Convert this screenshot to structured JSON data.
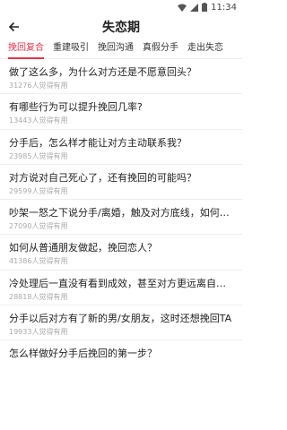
{
  "status_bar": {
    "time": "11:34"
  },
  "app_bar": {
    "back_icon": "arrow-left-icon",
    "title": "失恋期"
  },
  "tabs": [
    {
      "label": "挽回复合",
      "active": true
    },
    {
      "label": "重建吸引",
      "active": false
    },
    {
      "label": "挽回沟通",
      "active": false
    },
    {
      "label": "真假分手",
      "active": false
    },
    {
      "label": "走出失恋",
      "active": false
    }
  ],
  "items": [
    {
      "title": "做了这么多，为什么对方还是不愿意回头？",
      "meta": "31276人觉得有用"
    },
    {
      "title": "有哪些行为可以提升挽回几率?",
      "meta": "13443人觉得有用"
    },
    {
      "title": "分手后，怎么样才能让对方主动联系我？",
      "meta": "23985人觉得有用"
    },
    {
      "title": "对方说对自己死心了，还有挽回的可能吗？",
      "meta": "29599人觉得有用"
    },
    {
      "title": "吵架一怒之下说分手/离婚，触及对方底线，如何挽回",
      "meta": "27090人觉得有用"
    },
    {
      "title": "如何从普通朋友做起，挽回恋人？",
      "meta": "41386人觉得有用"
    },
    {
      "title": "冷处理后一直没有看到成效，甚至对方更远离自己，",
      "meta": "28818人觉得有用"
    },
    {
      "title": "分手以后对方有了新的男/女朋友，这时还想挽回TA",
      "meta": "19933人觉得有用"
    },
    {
      "title": "怎么样做好分手后挽回的第一步？",
      "meta": ""
    }
  ],
  "colors": {
    "accent": "#e8334a",
    "divider": "#eeeeee",
    "meta_text": "#aaaaaa"
  }
}
